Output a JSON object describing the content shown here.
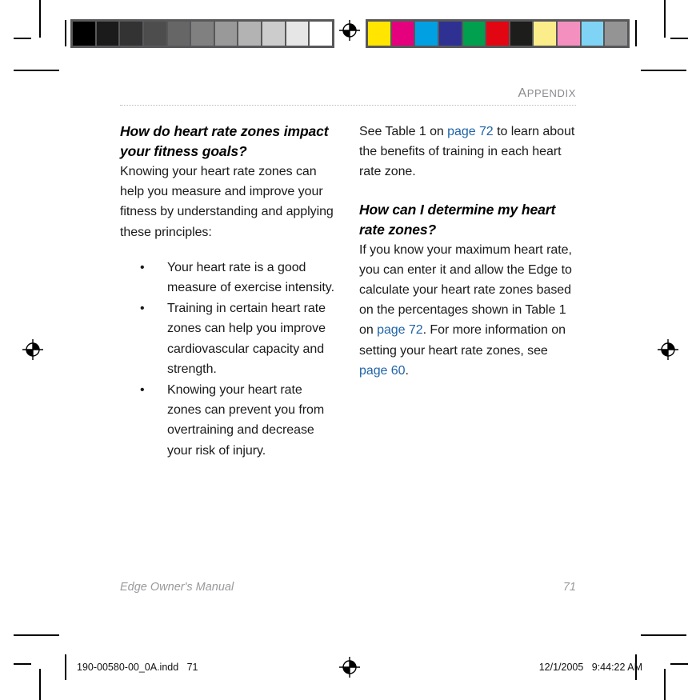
{
  "printers_marks": {
    "grayscale_strip": {
      "name": "grayscale-calibration-strip",
      "swatches": [
        "#000000",
        "#1b1b1b",
        "#333333",
        "#4d4d4d",
        "#666666",
        "#808080",
        "#999999",
        "#b3b3b3",
        "#cccccc",
        "#e6e6e6",
        "#ffffff"
      ]
    },
    "color_strip": {
      "name": "color-calibration-strip",
      "swatches": [
        "#ffe500",
        "#e5007e",
        "#00a0e3",
        "#2e3192",
        "#00a04e",
        "#e20613",
        "#1d1d1b",
        "#fbee8a",
        "#f490c0",
        "#7fd4f5",
        "#949494"
      ]
    },
    "registration_marks": [
      "registration-target-left",
      "registration-target-right",
      "registration-target-top",
      "registration-target-bottom"
    ]
  },
  "header": {
    "running_head": "Appendix",
    "running_head_first_letter": "A",
    "running_head_rest": "PPENDIX"
  },
  "left_column": {
    "heading": "How do heart rate zones impact your fitness goals?",
    "intro": "Knowing your heart rate zones can help you measure and improve your fitness by understanding and applying these principles:",
    "bullet_char": "•",
    "bullets": [
      "Your heart rate is a good measure of exercise intensity.",
      "Training in certain heart rate zones can help you improve cardiovascular capacity and strength.",
      "Knowing your heart rate zones can prevent you from overtraining and decrease your risk of injury."
    ]
  },
  "right_column": {
    "para1_part1": "See Table 1 on ",
    "para1_link1": "page 72",
    "para1_part2": " to learn about the benefits of training in each heart rate zone.",
    "heading": "How can I determine my heart rate zones?",
    "para2_part1": "If you know your maximum heart rate, you can enter it and allow the Edge to calculate your heart rate zones based on the percentages shown in Table 1 on ",
    "para2_link1": "page 72",
    "para2_part2": ". For more information on setting your heart rate zones, see ",
    "para2_link2": "page 60",
    "para2_part3": "."
  },
  "footer": {
    "doc_title": "Edge Owner's Manual",
    "page_number": "71"
  },
  "slug": {
    "filename": "190-00580-00_0A.indd   71",
    "date": "12/1/2005",
    "time": "9:44:22 AM"
  },
  "colors": {
    "link": "#1f63a8",
    "running_head": "#8b8b8e",
    "footer_text": "#9a9a9d",
    "body_text": "#1a1a1a",
    "strip_border": "#58585a"
  }
}
